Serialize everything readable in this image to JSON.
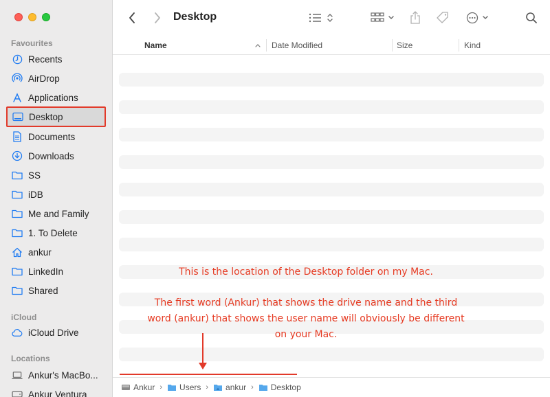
{
  "window": {
    "title": "Desktop"
  },
  "sidebar": {
    "favourites_title": "Favourites",
    "items": [
      {
        "label": "Recents",
        "icon": "clock-icon"
      },
      {
        "label": "AirDrop",
        "icon": "airdrop-icon"
      },
      {
        "label": "Applications",
        "icon": "applications-icon"
      },
      {
        "label": "Desktop",
        "icon": "desktop-icon",
        "selected": true
      },
      {
        "label": "Documents",
        "icon": "document-icon"
      },
      {
        "label": "Downloads",
        "icon": "download-icon"
      },
      {
        "label": "SS",
        "icon": "folder-icon"
      },
      {
        "label": "iDB",
        "icon": "folder-icon"
      },
      {
        "label": "Me and Family",
        "icon": "folder-icon"
      },
      {
        "label": "1. To Delete",
        "icon": "folder-icon"
      },
      {
        "label": "ankur",
        "icon": "home-icon"
      },
      {
        "label": "LinkedIn",
        "icon": "folder-icon"
      },
      {
        "label": "Shared",
        "icon": "folder-icon"
      }
    ],
    "icloud_title": "iCloud",
    "icloud_items": [
      {
        "label": "iCloud Drive",
        "icon": "cloud-icon"
      }
    ],
    "locations_title": "Locations",
    "location_items": [
      {
        "label": "Ankur's MacBo...",
        "icon": "laptop-icon"
      },
      {
        "label": "Ankur Ventura",
        "icon": "drive-icon"
      }
    ]
  },
  "columns": {
    "name": "Name",
    "date_modified": "Date Modified",
    "size": "Size",
    "kind": "Kind"
  },
  "annotation": {
    "line1": "This is the location of the Desktop folder on my Mac.",
    "line2": "The first word (Ankur) that shows the drive name and the third",
    "line3": "word (ankur) that shows the user name will obviously be different",
    "line4": "on your Mac.",
    "color": "#e63a22"
  },
  "pathbar": {
    "crumbs": [
      {
        "label": "Ankur",
        "icon": "drive-icon"
      },
      {
        "label": "Users",
        "icon": "folder-icon"
      },
      {
        "label": "ankur",
        "icon": "home-folder-icon"
      },
      {
        "label": "Desktop",
        "icon": "folder-icon"
      }
    ]
  }
}
